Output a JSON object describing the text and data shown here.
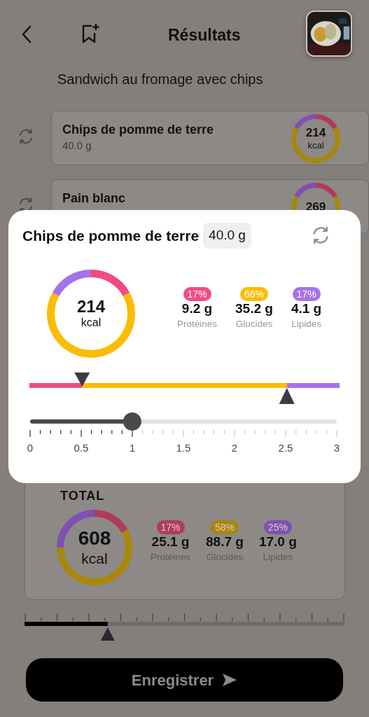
{
  "header": {
    "title": "Résultats"
  },
  "meal_name": "Sandwich au fromage avec chips",
  "items": [
    {
      "name": "Chips de pomme de terre",
      "weight": "40.0 g",
      "kcal": "214",
      "unit": "kcal",
      "segments": [
        {
          "color": "#b13a5f"
        },
        {
          "color": "#a8870a"
        },
        {
          "color": "#7e51b0"
        }
      ]
    },
    {
      "name": "Pain blanc",
      "kcal": "269",
      "segments": [
        {
          "color": "#b13a5f"
        },
        {
          "color": "#a8870a"
        },
        {
          "color": "#7e51b0"
        }
      ]
    }
  ],
  "detail": {
    "title": "Chips de pomme de terre",
    "weight": "40.0 g",
    "kcal": "214",
    "unit": "kcal",
    "macros": [
      {
        "percent": "17%",
        "amount": "9.2 g",
        "label": "Protéines",
        "color": "#f24a83"
      },
      {
        "percent": "66%",
        "amount": "35.2 g",
        "label": "Glucides",
        "color": "#fbbc05"
      },
      {
        "percent": "17%",
        "amount": "4.1 g",
        "label": "Lipides",
        "color": "#a572e8"
      }
    ],
    "portion_slider": {
      "level": 0.333,
      "ticks": [
        "0",
        "0.5",
        "1",
        "1.5",
        "2",
        "2.5",
        "3"
      ]
    }
  },
  "total": {
    "label": "TOTAL",
    "kcal": "608",
    "unit": "kcal",
    "macros": [
      {
        "percent": "17%",
        "amount": "25.1 g",
        "label": "Protéines",
        "color": "#b13a5f"
      },
      {
        "percent": "58%",
        "amount": "88.7 g",
        "label": "Glucides",
        "color": "#a8870a"
      },
      {
        "percent": "25%",
        "amount": "17.0 g",
        "label": "Lipides",
        "color": "#7e51b0"
      }
    ]
  },
  "scale": {
    "level": 0.26
  },
  "save_button": {
    "label": "Enregistrer"
  }
}
